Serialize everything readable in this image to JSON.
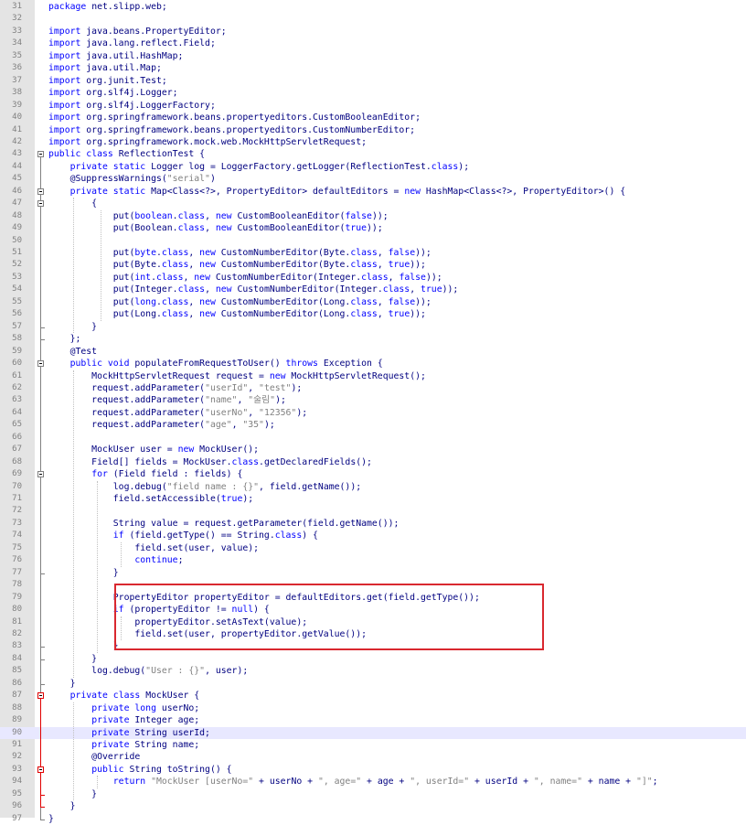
{
  "editor": {
    "highlighted_line": 90,
    "annotation_color": "#d9282f",
    "lines": [
      {
        "n": "31",
        "segs": [
          {
            "t": "package",
            "c": "kw"
          },
          {
            "t": " net.slipp.web;"
          }
        ]
      },
      {
        "n": "32",
        "segs": []
      },
      {
        "n": "33",
        "segs": [
          {
            "t": "import",
            "c": "kw"
          },
          {
            "t": " java.beans.PropertyEditor;"
          }
        ]
      },
      {
        "n": "34",
        "segs": [
          {
            "t": "import",
            "c": "kw"
          },
          {
            "t": " java.lang.reflect.Field;"
          }
        ]
      },
      {
        "n": "35",
        "segs": [
          {
            "t": "import",
            "c": "kw"
          },
          {
            "t": " java.util.HashMap;"
          }
        ]
      },
      {
        "n": "36",
        "segs": [
          {
            "t": "import",
            "c": "kw"
          },
          {
            "t": " java.util.Map;"
          }
        ]
      },
      {
        "n": "37",
        "segs": [
          {
            "t": "import",
            "c": "kw"
          },
          {
            "t": " org.junit.Test;"
          }
        ]
      },
      {
        "n": "38",
        "segs": [
          {
            "t": "import",
            "c": "kw"
          },
          {
            "t": " org.slf4j.Logger;"
          }
        ]
      },
      {
        "n": "39",
        "segs": [
          {
            "t": "import",
            "c": "kw"
          },
          {
            "t": " org.slf4j.LoggerFactory;"
          }
        ]
      },
      {
        "n": "40",
        "segs": [
          {
            "t": "import",
            "c": "kw"
          },
          {
            "t": " org.springframework.beans.propertyeditors.CustomBooleanEditor;"
          }
        ]
      },
      {
        "n": "41",
        "segs": [
          {
            "t": "import",
            "c": "kw"
          },
          {
            "t": " org.springframework.beans.propertyeditors.CustomNumberEditor;"
          }
        ]
      },
      {
        "n": "42",
        "segs": [
          {
            "t": "import",
            "c": "kw"
          },
          {
            "t": " org.springframework.mock.web.MockHttpServletRequest;"
          }
        ]
      },
      {
        "n": "43",
        "segs": [
          {
            "t": "public",
            "c": "kw"
          },
          {
            "t": " "
          },
          {
            "t": "class",
            "c": "kw"
          },
          {
            "t": " ReflectionTest {"
          }
        ]
      },
      {
        "n": "44",
        "segs": [
          {
            "t": "    "
          },
          {
            "t": "private",
            "c": "kw"
          },
          {
            "t": " "
          },
          {
            "t": "static",
            "c": "kw"
          },
          {
            "t": " Logger log = LoggerFactory.getLogger(ReflectionTest."
          },
          {
            "t": "class",
            "c": "kw"
          },
          {
            "t": ");"
          }
        ]
      },
      {
        "n": "45",
        "segs": [
          {
            "t": "    @SuppressWarnings("
          },
          {
            "t": "\"serial\"",
            "c": "str"
          },
          {
            "t": ")"
          }
        ]
      },
      {
        "n": "46",
        "segs": [
          {
            "t": "    "
          },
          {
            "t": "private",
            "c": "kw"
          },
          {
            "t": " "
          },
          {
            "t": "static",
            "c": "kw"
          },
          {
            "t": " Map<Class<?>, PropertyEditor> defaultEditors = "
          },
          {
            "t": "new",
            "c": "kw"
          },
          {
            "t": " HashMap<Class<?>, PropertyEditor>() {"
          }
        ]
      },
      {
        "n": "47",
        "segs": [
          {
            "t": "        {"
          }
        ]
      },
      {
        "n": "48",
        "segs": [
          {
            "t": "            put("
          },
          {
            "t": "boolean",
            "c": "kw"
          },
          {
            "t": "."
          },
          {
            "t": "class",
            "c": "kw"
          },
          {
            "t": ", "
          },
          {
            "t": "new",
            "c": "kw"
          },
          {
            "t": " CustomBooleanEditor("
          },
          {
            "t": "false",
            "c": "kw"
          },
          {
            "t": "));"
          }
        ]
      },
      {
        "n": "49",
        "segs": [
          {
            "t": "            put(Boolean."
          },
          {
            "t": "class",
            "c": "kw"
          },
          {
            "t": ", "
          },
          {
            "t": "new",
            "c": "kw"
          },
          {
            "t": " CustomBooleanEditor("
          },
          {
            "t": "true",
            "c": "kw"
          },
          {
            "t": "));"
          }
        ]
      },
      {
        "n": "50",
        "segs": []
      },
      {
        "n": "51",
        "segs": [
          {
            "t": "            put("
          },
          {
            "t": "byte",
            "c": "kw"
          },
          {
            "t": "."
          },
          {
            "t": "class",
            "c": "kw"
          },
          {
            "t": ", "
          },
          {
            "t": "new",
            "c": "kw"
          },
          {
            "t": " CustomNumberEditor(Byte."
          },
          {
            "t": "class",
            "c": "kw"
          },
          {
            "t": ", "
          },
          {
            "t": "false",
            "c": "kw"
          },
          {
            "t": "));"
          }
        ]
      },
      {
        "n": "52",
        "segs": [
          {
            "t": "            put(Byte."
          },
          {
            "t": "class",
            "c": "kw"
          },
          {
            "t": ", "
          },
          {
            "t": "new",
            "c": "kw"
          },
          {
            "t": " CustomNumberEditor(Byte."
          },
          {
            "t": "class",
            "c": "kw"
          },
          {
            "t": ", "
          },
          {
            "t": "true",
            "c": "kw"
          },
          {
            "t": "));"
          }
        ]
      },
      {
        "n": "53",
        "segs": [
          {
            "t": "            put("
          },
          {
            "t": "int",
            "c": "kw"
          },
          {
            "t": "."
          },
          {
            "t": "class",
            "c": "kw"
          },
          {
            "t": ", "
          },
          {
            "t": "new",
            "c": "kw"
          },
          {
            "t": " CustomNumberEditor(Integer."
          },
          {
            "t": "class",
            "c": "kw"
          },
          {
            "t": ", "
          },
          {
            "t": "false",
            "c": "kw"
          },
          {
            "t": "));"
          }
        ]
      },
      {
        "n": "54",
        "segs": [
          {
            "t": "            put(Integer."
          },
          {
            "t": "class",
            "c": "kw"
          },
          {
            "t": ", "
          },
          {
            "t": "new",
            "c": "kw"
          },
          {
            "t": " CustomNumberEditor(Integer."
          },
          {
            "t": "class",
            "c": "kw"
          },
          {
            "t": ", "
          },
          {
            "t": "true",
            "c": "kw"
          },
          {
            "t": "));"
          }
        ]
      },
      {
        "n": "55",
        "segs": [
          {
            "t": "            put("
          },
          {
            "t": "long",
            "c": "kw"
          },
          {
            "t": "."
          },
          {
            "t": "class",
            "c": "kw"
          },
          {
            "t": ", "
          },
          {
            "t": "new",
            "c": "kw"
          },
          {
            "t": " CustomNumberEditor(Long."
          },
          {
            "t": "class",
            "c": "kw"
          },
          {
            "t": ", "
          },
          {
            "t": "false",
            "c": "kw"
          },
          {
            "t": "));"
          }
        ]
      },
      {
        "n": "56",
        "segs": [
          {
            "t": "            put(Long."
          },
          {
            "t": "class",
            "c": "kw"
          },
          {
            "t": ", "
          },
          {
            "t": "new",
            "c": "kw"
          },
          {
            "t": " CustomNumberEditor(Long."
          },
          {
            "t": "class",
            "c": "kw"
          },
          {
            "t": ", "
          },
          {
            "t": "true",
            "c": "kw"
          },
          {
            "t": "));"
          }
        ]
      },
      {
        "n": "57",
        "segs": [
          {
            "t": "        }"
          }
        ]
      },
      {
        "n": "58",
        "segs": [
          {
            "t": "    };"
          }
        ]
      },
      {
        "n": "59",
        "segs": [
          {
            "t": "    @Test"
          }
        ]
      },
      {
        "n": "60",
        "segs": [
          {
            "t": "    "
          },
          {
            "t": "public",
            "c": "kw"
          },
          {
            "t": " "
          },
          {
            "t": "void",
            "c": "kw"
          },
          {
            "t": " populateFromRequestToUser() "
          },
          {
            "t": "throws",
            "c": "kw"
          },
          {
            "t": " Exception {"
          }
        ]
      },
      {
        "n": "61",
        "segs": [
          {
            "t": "        MockHttpServletRequest request = "
          },
          {
            "t": "new",
            "c": "kw"
          },
          {
            "t": " MockHttpServletRequest();"
          }
        ]
      },
      {
        "n": "62",
        "segs": [
          {
            "t": "        request.addParameter("
          },
          {
            "t": "\"userId\"",
            "c": "str"
          },
          {
            "t": ", "
          },
          {
            "t": "\"test\"",
            "c": "str"
          },
          {
            "t": ");"
          }
        ]
      },
      {
        "n": "63",
        "segs": [
          {
            "t": "        request.addParameter("
          },
          {
            "t": "\"name\"",
            "c": "str"
          },
          {
            "t": ", "
          },
          {
            "t": "\"술림\"",
            "c": "str"
          },
          {
            "t": ");"
          }
        ]
      },
      {
        "n": "64",
        "segs": [
          {
            "t": "        request.addParameter("
          },
          {
            "t": "\"userNo\"",
            "c": "str"
          },
          {
            "t": ", "
          },
          {
            "t": "\"12356\"",
            "c": "str"
          },
          {
            "t": ");"
          }
        ]
      },
      {
        "n": "65",
        "segs": [
          {
            "t": "        request.addParameter("
          },
          {
            "t": "\"age\"",
            "c": "str"
          },
          {
            "t": ", "
          },
          {
            "t": "\"35\"",
            "c": "str"
          },
          {
            "t": ");"
          }
        ]
      },
      {
        "n": "66",
        "segs": []
      },
      {
        "n": "67",
        "segs": [
          {
            "t": "        MockUser user = "
          },
          {
            "t": "new",
            "c": "kw"
          },
          {
            "t": " MockUser();"
          }
        ]
      },
      {
        "n": "68",
        "segs": [
          {
            "t": "        Field[] fields = MockUser."
          },
          {
            "t": "class",
            "c": "kw"
          },
          {
            "t": ".getDeclaredFields();"
          }
        ]
      },
      {
        "n": "69",
        "segs": [
          {
            "t": "        "
          },
          {
            "t": "for",
            "c": "kw"
          },
          {
            "t": " (Field field : fields) {"
          }
        ]
      },
      {
        "n": "70",
        "segs": [
          {
            "t": "            log.debug("
          },
          {
            "t": "\"field name : {}\"",
            "c": "str"
          },
          {
            "t": ", field.getName());"
          }
        ]
      },
      {
        "n": "71",
        "segs": [
          {
            "t": "            field.setAccessible("
          },
          {
            "t": "true",
            "c": "kw"
          },
          {
            "t": ");"
          }
        ]
      },
      {
        "n": "72",
        "segs": []
      },
      {
        "n": "73",
        "segs": [
          {
            "t": "            String value = request.getParameter(field.getName());"
          }
        ]
      },
      {
        "n": "74",
        "segs": [
          {
            "t": "            "
          },
          {
            "t": "if",
            "c": "kw"
          },
          {
            "t": " (field.getType() == String."
          },
          {
            "t": "class",
            "c": "kw"
          },
          {
            "t": ") {"
          }
        ]
      },
      {
        "n": "75",
        "segs": [
          {
            "t": "                field.set(user, value);"
          }
        ]
      },
      {
        "n": "76",
        "segs": [
          {
            "t": "                "
          },
          {
            "t": "continue",
            "c": "kw"
          },
          {
            "t": ";"
          }
        ]
      },
      {
        "n": "77",
        "segs": [
          {
            "t": "            }"
          }
        ]
      },
      {
        "n": "78",
        "segs": []
      },
      {
        "n": "79",
        "segs": [
          {
            "t": "            PropertyEditor propertyEditor = defaultEditors.get(field.getType());"
          }
        ]
      },
      {
        "n": "80",
        "segs": [
          {
            "t": "            "
          },
          {
            "t": "if",
            "c": "kw"
          },
          {
            "t": " (propertyEditor != "
          },
          {
            "t": "null",
            "c": "kw"
          },
          {
            "t": ") {"
          }
        ]
      },
      {
        "n": "81",
        "segs": [
          {
            "t": "                propertyEditor.setAsText(value);"
          }
        ]
      },
      {
        "n": "82",
        "segs": [
          {
            "t": "                field.set(user, propertyEditor.getValue());"
          }
        ]
      },
      {
        "n": "83",
        "segs": [
          {
            "t": "            }"
          }
        ]
      },
      {
        "n": "84",
        "segs": [
          {
            "t": "        }"
          }
        ]
      },
      {
        "n": "85",
        "segs": [
          {
            "t": "        log.debug("
          },
          {
            "t": "\"User : {}\"",
            "c": "str"
          },
          {
            "t": ", user);"
          }
        ]
      },
      {
        "n": "86",
        "segs": [
          {
            "t": "    }"
          }
        ]
      },
      {
        "n": "87",
        "segs": [
          {
            "t": "    "
          },
          {
            "t": "private",
            "c": "kw"
          },
          {
            "t": " "
          },
          {
            "t": "class",
            "c": "kw"
          },
          {
            "t": " MockUser {"
          }
        ]
      },
      {
        "n": "88",
        "segs": [
          {
            "t": "        "
          },
          {
            "t": "private",
            "c": "kw"
          },
          {
            "t": " "
          },
          {
            "t": "long",
            "c": "kw"
          },
          {
            "t": " userNo;"
          }
        ]
      },
      {
        "n": "89",
        "segs": [
          {
            "t": "        "
          },
          {
            "t": "private",
            "c": "kw"
          },
          {
            "t": " Integer age;"
          }
        ]
      },
      {
        "n": "90",
        "segs": [
          {
            "t": "        "
          },
          {
            "t": "private",
            "c": "kw"
          },
          {
            "t": " String userId;"
          }
        ]
      },
      {
        "n": "91",
        "segs": [
          {
            "t": "        "
          },
          {
            "t": "private",
            "c": "kw"
          },
          {
            "t": " String name;"
          }
        ]
      },
      {
        "n": "92",
        "segs": [
          {
            "t": "        @Override"
          }
        ]
      },
      {
        "n": "93",
        "segs": [
          {
            "t": "        "
          },
          {
            "t": "public",
            "c": "kw"
          },
          {
            "t": " String toString() {"
          }
        ]
      },
      {
        "n": "94",
        "segs": [
          {
            "t": "            "
          },
          {
            "t": "return",
            "c": "kw"
          },
          {
            "t": " "
          },
          {
            "t": "\"MockUser [userNo=\"",
            "c": "str"
          },
          {
            "t": " + userNo + "
          },
          {
            "t": "\", age=\"",
            "c": "str"
          },
          {
            "t": " + age + "
          },
          {
            "t": "\", userId=\"",
            "c": "str"
          },
          {
            "t": " + userId + "
          },
          {
            "t": "\", name=\"",
            "c": "str"
          },
          {
            "t": " + name + "
          },
          {
            "t": "\"]\"",
            "c": "str"
          },
          {
            "t": ";"
          }
        ]
      },
      {
        "n": "95",
        "segs": [
          {
            "t": "        }"
          }
        ]
      },
      {
        "n": "96",
        "segs": [
          {
            "t": "    }"
          }
        ]
      },
      {
        "n": "97",
        "segs": [
          {
            "t": "}"
          }
        ]
      }
    ]
  }
}
